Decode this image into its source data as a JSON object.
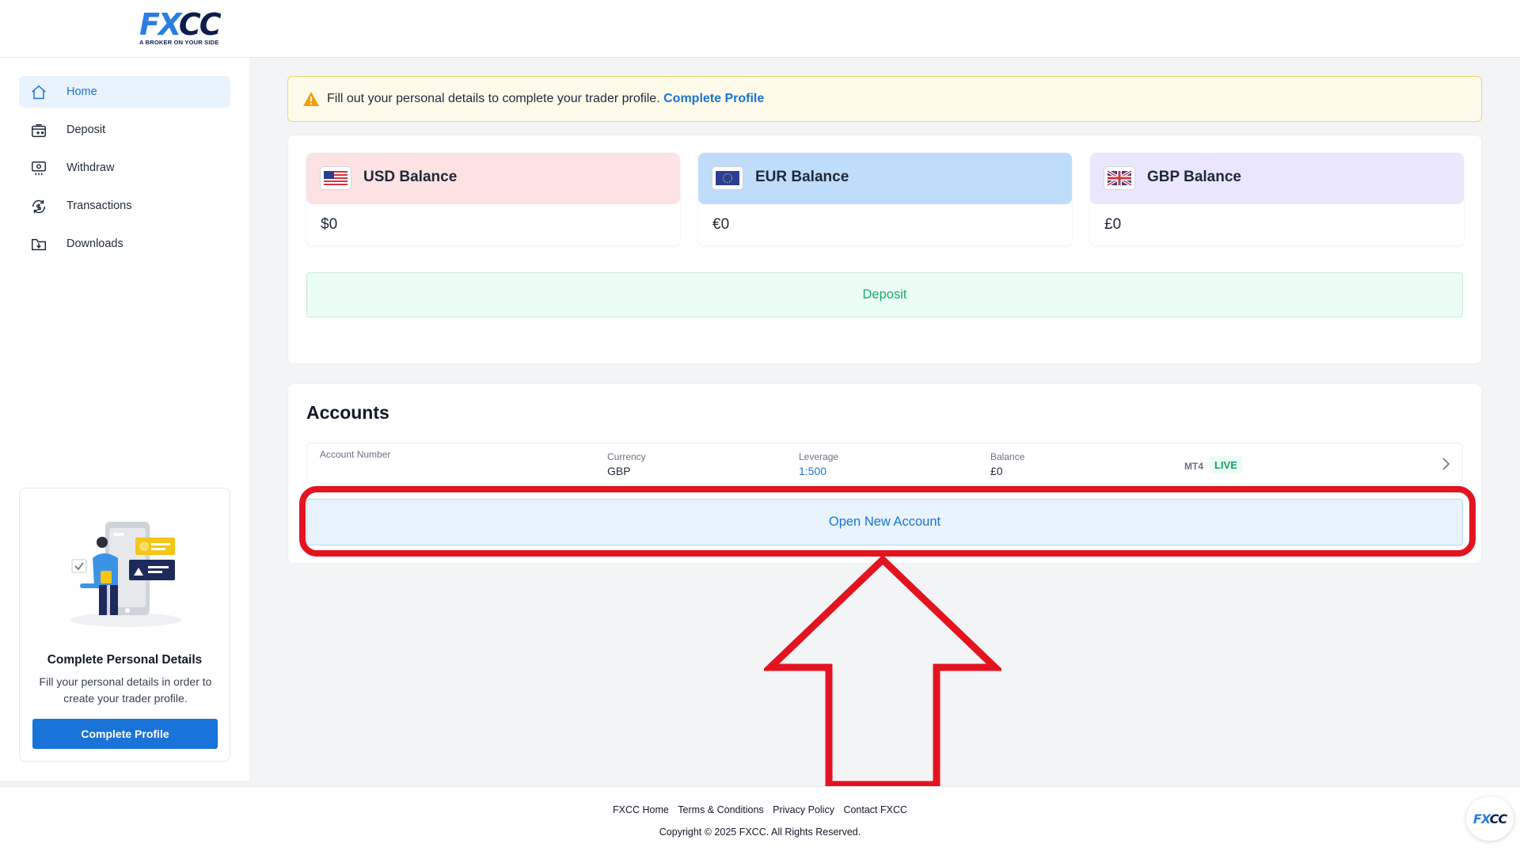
{
  "brand": {
    "logo_fx": "FX",
    "logo_cc": "CC",
    "tagline": "A BROKER ON YOUR SIDE",
    "primary_color": "#1a73d9",
    "navy_color": "#0f1d4d"
  },
  "sidebar": {
    "items": [
      {
        "label": "Home",
        "icon": "home-icon",
        "active": true
      },
      {
        "label": "Deposit",
        "icon": "deposit-wallet-icon",
        "active": false
      },
      {
        "label": "Withdraw",
        "icon": "withdraw-cash-icon",
        "active": false
      },
      {
        "label": "Transactions",
        "icon": "transactions-icon",
        "active": false
      },
      {
        "label": "Downloads",
        "icon": "downloads-folder-icon",
        "active": false
      }
    ],
    "promo": {
      "title": "Complete Personal Details",
      "text": "Fill your personal details in order to create your trader profile.",
      "button": "Complete Profile"
    }
  },
  "alert": {
    "text": "Fill out your personal details to complete your trader profile.",
    "link": "Complete Profile"
  },
  "balances": [
    {
      "title": "USD Balance",
      "amount": "$0",
      "flag": "us-flag-icon",
      "color": "#fde2e4"
    },
    {
      "title": "EUR Balance",
      "amount": "€0",
      "flag": "eu-flag-icon",
      "color": "#bfdcfb"
    },
    {
      "title": "GBP Balance",
      "amount": "£0",
      "flag": "uk-flag-icon",
      "color": "#e9e6fd"
    }
  ],
  "deposit_button": "Deposit",
  "accounts": {
    "title": "Accounts",
    "row": {
      "account_number_label": "Account Number",
      "currency_label": "Currency",
      "currency": "GBP",
      "leverage_label": "Leverage",
      "leverage": "1:500",
      "balance_label": "Balance",
      "balance": "£0",
      "platform": "MT4",
      "type": "LIVE"
    },
    "open_new_button": "Open New Account"
  },
  "footer": {
    "links": [
      "FXCC Home",
      "Terms & Conditions",
      "Privacy Policy",
      "Contact FXCC"
    ],
    "copyright": "Copyright © 2025 FXCC. All Rights Reserved."
  }
}
